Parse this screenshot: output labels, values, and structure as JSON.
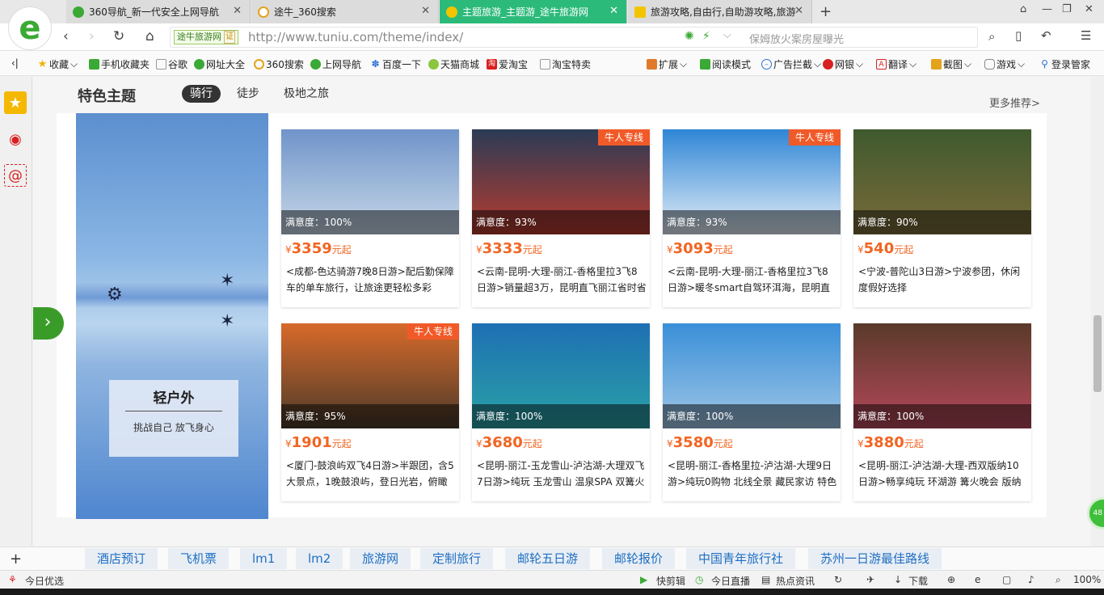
{
  "browser": {
    "tabs": [
      {
        "label": "360导航_新一代安全上网导航",
        "icon_color": "#3aa935"
      },
      {
        "label": "途牛_360搜索",
        "icon_color": "#e3a31b"
      },
      {
        "label": "主题旅游_主题游_途牛旅游网",
        "icon_color": "#f2c500"
      },
      {
        "label": "旅游攻略,自由行,自助游攻略,旅游",
        "icon_color": "#f2c500"
      }
    ],
    "cert_label": "途牛旅游网",
    "cert_badge": "证",
    "url": "http://www.tuniu.com/theme/index/",
    "suggest": "保姆放火案房屋曝光",
    "favorites": [
      "收藏",
      "手机收藏夹",
      "谷歌",
      "网址大全",
      "360搜索",
      "上网导航",
      "百度一下",
      "天猫商城",
      "爱淘宝",
      "淘宝特卖"
    ],
    "tools": [
      "扩展",
      "阅读模式",
      "广告拦截",
      "网银",
      "翻译",
      "截图",
      "游戏",
      "登录管家"
    ]
  },
  "section": {
    "title": "特色主题",
    "tabs": [
      "骑行",
      "徒步",
      "极地之旅"
    ],
    "active_tab": 0,
    "more": "更多推荐>"
  },
  "banner": {
    "title": "轻户外",
    "subtitle": "挑战自己 放飞身心"
  },
  "cards": [
    {
      "sat": "满意度：100%",
      "price": "3359",
      "unit": "元起",
      "tag": "",
      "desc": "<成都-色达骑游7晚8日游>配后勤保障车的单车旅行，让旅途更轻松多彩",
      "img_top": "#6f94c9",
      "img_bot": "#c8d8e8"
    },
    {
      "sat": "满意度：93%",
      "price": "3333",
      "unit": "元起",
      "tag": "牛人专线",
      "desc": "<云南-昆明-大理-丽江-香格里拉3飞8日游>销量超3万，昆明直飞丽江省时省",
      "img_top": "#2a3b56",
      "img_bot": "#b83b2e"
    },
    {
      "sat": "满意度：93%",
      "price": "3093",
      "unit": "元起",
      "tag": "牛人专线",
      "desc": "<云南-昆明-大理-丽江-香格里拉3飞8日游>暖冬smart自驾环洱海，昆明直",
      "img_top": "#2f86d6",
      "img_bot": "#e4eef7"
    },
    {
      "sat": "满意度：90%",
      "price": "540",
      "unit": "元起",
      "tag": "",
      "desc": "<宁波-普陀山3日游>宁波参团，休闲度假好选择",
      "img_top": "#3f5a2e",
      "img_bot": "#7a6a3a"
    },
    {
      "sat": "满意度：95%",
      "price": "1901",
      "unit": "元起",
      "tag": "牛人专线",
      "desc": "<厦门-鼓浪屿双飞4日游>半跟团，含5大景点，1晚鼓浪屿，登日光岩，俯瞰",
      "img_top": "#d86a2a",
      "img_bot": "#4a3a2a"
    },
    {
      "sat": "满意度：100%",
      "price": "3680",
      "unit": "元起",
      "tag": "",
      "desc": "<昆明-丽江-玉龙雪山-泸沽湖-大理双飞7日游>纯玩 玉龙雪山 温泉SPA 双篝火",
      "img_top": "#1e6fb3",
      "img_bot": "#2aa2a6"
    },
    {
      "sat": "满意度：100%",
      "price": "3580",
      "unit": "元起",
      "tag": "",
      "desc": "<昆明-丽江-香格里拉-泸沽湖-大理9日游>纯玩0购物 北线全景 藏民家访 特色",
      "img_top": "#3a8fd8",
      "img_bot": "#9fc6e6"
    },
    {
      "sat": "满意度：100%",
      "price": "3880",
      "unit": "元起",
      "tag": "",
      "desc": "<昆明-丽江-泸沽湖-大理-西双版纳10日游>畅享纯玩 环湖游 篝火晚会 版纳",
      "img_top": "#5a3a2a",
      "img_bot": "#b5485a"
    }
  ],
  "hotlinks": [
    "酒店预订",
    "飞机票",
    "lm1",
    "lm2",
    "旅游网",
    "定制旅行",
    "邮轮五日游",
    "邮轮报价",
    "中国青年旅行社",
    "苏州一日游最佳路线"
  ],
  "status": {
    "left": "今日优选",
    "items": [
      "快剪辑",
      "今日直播",
      "热点资讯",
      "下载"
    ],
    "zoom": "100%",
    "float_ball": "48"
  }
}
